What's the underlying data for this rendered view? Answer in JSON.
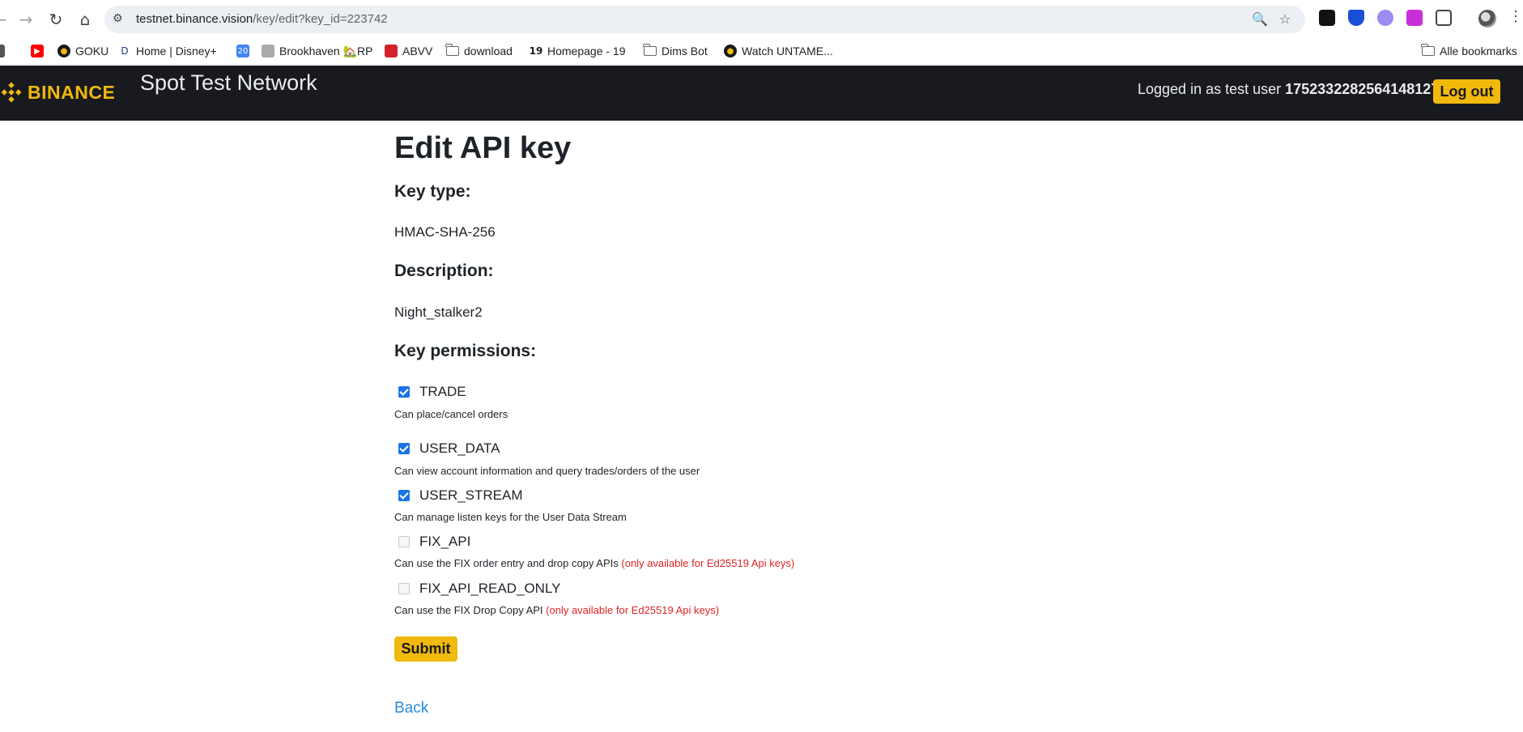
{
  "browser": {
    "url_host": "testnet.binance.vision",
    "url_path": "/key/edit?key_id=223742",
    "bookmarks": [
      {
        "label": "",
        "icon": "youtube-icon",
        "color": "#ff0000"
      },
      {
        "label": "GOKU",
        "icon": "goku-icon",
        "color": "#1a1a1a"
      },
      {
        "label": "Home | Disney+",
        "icon": "disney-icon",
        "color": "#1d3a8a"
      },
      {
        "label": "",
        "icon": "calendar-icon",
        "color": "#4285f4"
      },
      {
        "label": "Brookhaven 🏡RP",
        "icon": "roblox-icon",
        "color": "#999999"
      },
      {
        "label": "ABVV",
        "icon": "abvv-icon",
        "color": "#d2232a"
      },
      {
        "label": "download",
        "icon": "folder-icon",
        "color": "#5f6368"
      },
      {
        "label": "Homepage - 19",
        "icon": "site-icon",
        "color": "#222222"
      },
      {
        "label": "Dims Bot",
        "icon": "folder-icon",
        "color": "#5f6368"
      },
      {
        "label": "Watch UNTAME...",
        "icon": "watch-icon",
        "color": "#1a1a1a"
      }
    ],
    "all_bookmarks_label": "Alle bookmarks"
  },
  "header": {
    "logo_text": "BINANCE",
    "title": "Spot Test Network",
    "login_prefix": "Logged in as test user ",
    "user_id": "1752332282564148127",
    "logout_label": "Log out"
  },
  "main": {
    "page_title": "Edit API key",
    "key_type_label": "Key type:",
    "key_type_value": "HMAC-SHA-256",
    "description_label": "Description:",
    "description_value": "Night_stalker2",
    "permissions_label": "Key permissions:",
    "permissions": [
      {
        "name": "TRADE",
        "checked": true,
        "enabled": true,
        "desc": "Can place/cancel orders",
        "note": ""
      },
      {
        "name": "USER_DATA",
        "checked": true,
        "enabled": true,
        "desc": "Can view account information and query trades/orders of the user",
        "note": ""
      },
      {
        "name": "USER_STREAM",
        "checked": true,
        "enabled": true,
        "desc": "Can manage listen keys for the User Data Stream",
        "note": ""
      },
      {
        "name": "FIX_API",
        "checked": false,
        "enabled": false,
        "desc": "Can use the FIX order entry and drop copy APIs ",
        "note": "(only available for Ed25519 Api keys)"
      },
      {
        "name": "FIX_API_READ_ONLY",
        "checked": false,
        "enabled": false,
        "desc": "Can use the FIX Drop Copy API ",
        "note": "(only available for Ed25519 Api keys)"
      }
    ],
    "submit_label": "Submit",
    "back_label": "Back"
  },
  "colors": {
    "accent": "#f0b90b",
    "header_bg": "#181a20",
    "link": "#2a8ad8",
    "warning": "#e02424",
    "checkbox": "#1a73e8"
  }
}
